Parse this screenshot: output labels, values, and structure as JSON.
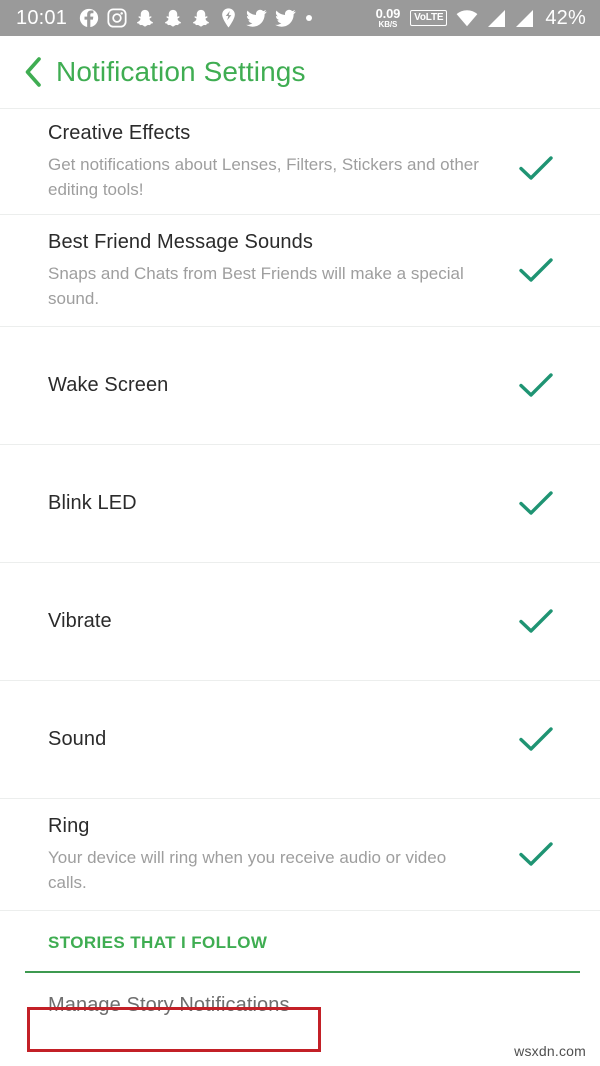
{
  "status_bar": {
    "clock": "10:01",
    "left_icons": [
      {
        "name": "facebook-icon"
      },
      {
        "name": "instagram-icon"
      },
      {
        "name": "snapchat-ghost-icon"
      },
      {
        "name": "snapchat-ghost-icon"
      },
      {
        "name": "snapchat-ghost-icon"
      },
      {
        "name": "snapchat-bolt-icon"
      },
      {
        "name": "twitter-bird-icon"
      },
      {
        "name": "twitter-bird-icon"
      },
      {
        "name": "more-notifications-dot"
      }
    ],
    "net_speed_value": "0.09",
    "net_speed_unit": "KB/S",
    "volte_label": "VoLTE",
    "wifi_icon": "wifi-icon",
    "signal_icons": [
      "signal-bars-icon",
      "signal-bars-icon"
    ],
    "battery_percent": "42%"
  },
  "app_bar": {
    "back_icon": "back-chevron-icon",
    "title": "Notification Settings",
    "accent_color": "#3fad52"
  },
  "settings": {
    "check_color": "#1f9473",
    "rows": [
      {
        "title": "Creative Effects",
        "subtitle": "Get notifications about Lenses, Filters, Stickers and other editing tools!",
        "checked": true
      },
      {
        "title": "Best Friend Message Sounds",
        "subtitle": "Snaps and Chats from Best Friends will make a special sound.",
        "checked": true
      },
      {
        "title": "Wake Screen",
        "subtitle": "",
        "checked": true
      },
      {
        "title": "Blink LED",
        "subtitle": "",
        "checked": true
      },
      {
        "title": "Vibrate",
        "subtitle": "",
        "checked": true
      },
      {
        "title": "Sound",
        "subtitle": "",
        "checked": true
      },
      {
        "title": "Ring",
        "subtitle": "Your device will ring when you receive audio or video calls.",
        "checked": true
      }
    ]
  },
  "section": {
    "title": "STORIES THAT I FOLLOW",
    "rule_color": "#3e9a50"
  },
  "footer": {
    "manage_label": "Manage Story Notifications",
    "highlight_color": "#c32027"
  },
  "watermark": {
    "text": "wsxdn.com"
  }
}
